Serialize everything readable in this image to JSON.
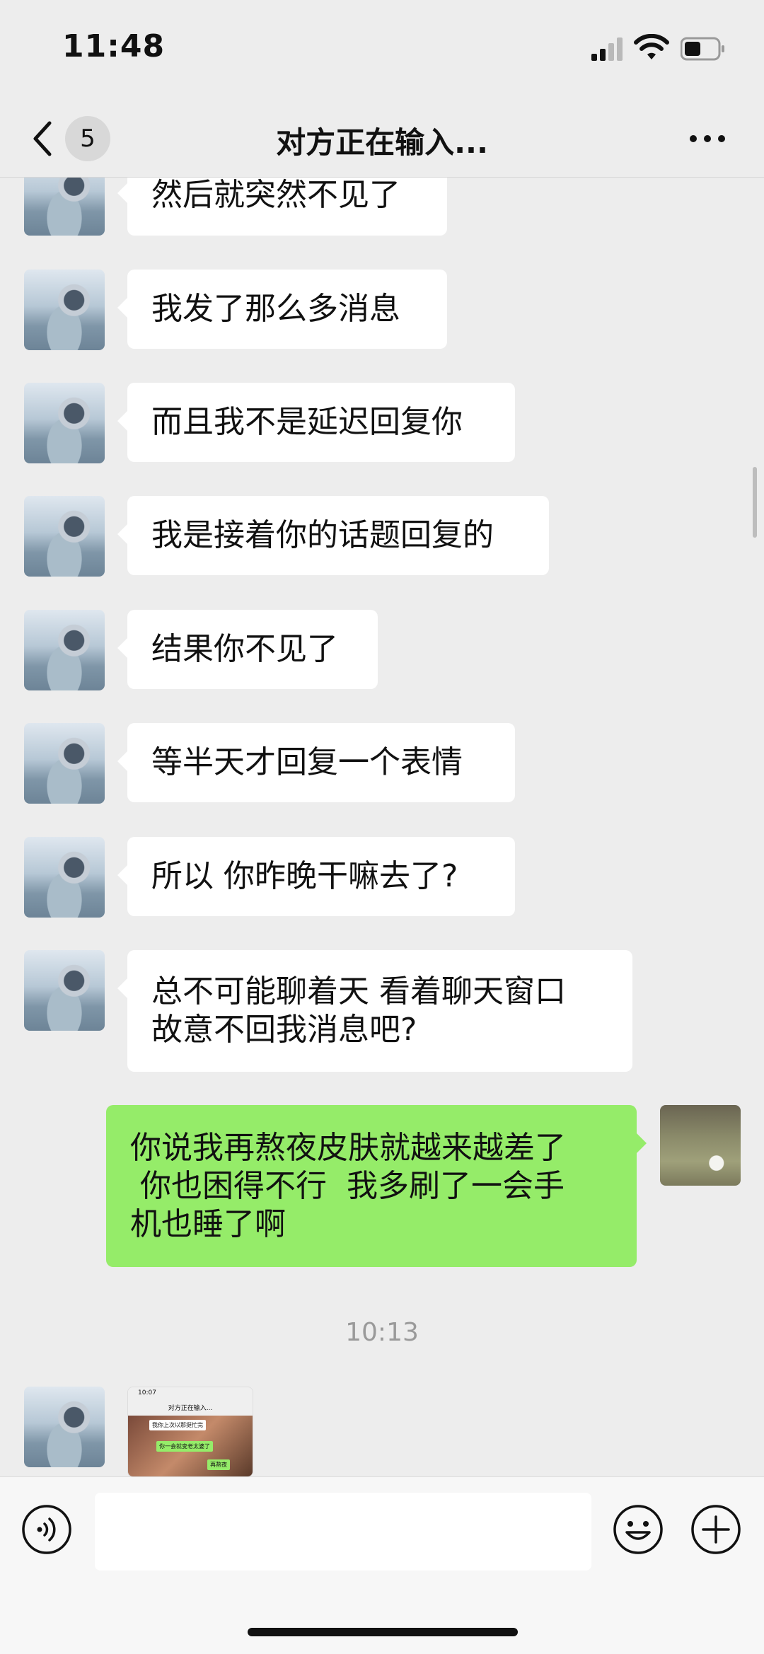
{
  "status_bar": {
    "time": "11:48"
  },
  "header": {
    "back_badge": "5",
    "title": "对方正在输入..."
  },
  "messages": [
    {
      "from": "other",
      "text": "然后就突然不见了"
    },
    {
      "from": "other",
      "text": "我发了那么多消息"
    },
    {
      "from": "other",
      "text": "而且我不是延迟回复你"
    },
    {
      "from": "other",
      "text": "我是接着你的话题回复的"
    },
    {
      "from": "other",
      "text": "结果你不见了"
    },
    {
      "from": "other",
      "text": "等半天才回复一个表情"
    },
    {
      "from": "other",
      "text": "所以 你昨晚干嘛去了?"
    },
    {
      "from": "other",
      "lines": [
        "总不可能聊着天 看着聊天窗口",
        "故意不回我消息吧?"
      ]
    },
    {
      "from": "me",
      "lines": [
        "你说我再熬夜皮肤就越来越差了",
        " 你也困得不行  我多刷了一会手",
        "机也睡了啊"
      ]
    },
    {
      "type": "timestamp",
      "text": "10:13"
    },
    {
      "from": "other",
      "type": "image",
      "thumbnail": {
        "time": "10:07",
        "title": "对方正在输入...",
        "bubbles": [
          "我你上次以那挺忙完",
          "你一会就变老太婆了",
          "再熬夜"
        ]
      }
    }
  ],
  "input": {
    "placeholder": ""
  },
  "icons": {
    "back": "chevron-left-icon",
    "more": "more-dots-icon",
    "voice": "voice-icon",
    "emoji": "emoji-icon",
    "plus": "plus-icon"
  },
  "colors": {
    "background": "#ededed",
    "bubble_other": "#ffffff",
    "bubble_me": "#95ec69",
    "timestamp": "#9a9a9a"
  }
}
